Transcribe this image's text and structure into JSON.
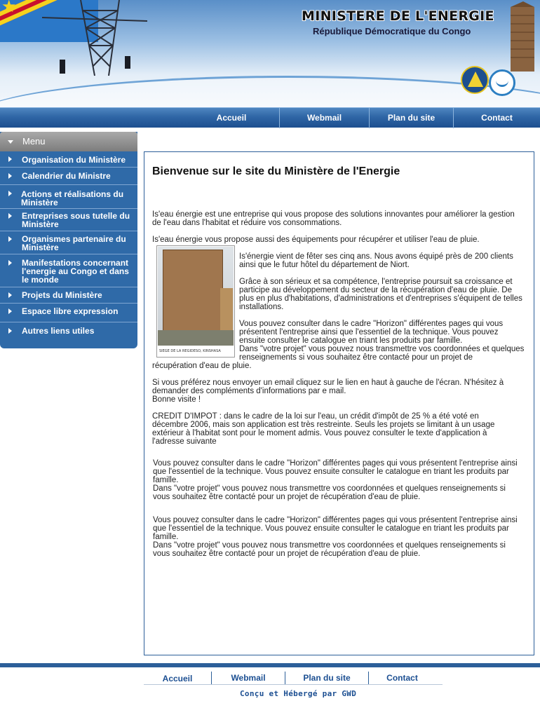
{
  "header": {
    "title": "MINISTERE DE L'ENERGIE",
    "subtitle": "République Démocratique du Congo"
  },
  "topnav": [
    "Accueil",
    "Webmail",
    "Plan du site",
    "Contact"
  ],
  "menu": {
    "header": "Menu",
    "items": [
      "Organisation du Ministère",
      "Calendrier du Ministre",
      "Actions et réalisations du Ministère",
      "Entreprises sous tutelle du Ministère",
      "Organismes partenaire du Ministère",
      "Manifestations concernant l'energie au Congo et dans le  monde",
      "Projets  du Ministère",
      "Espace libre expression",
      "Autres liens utiles"
    ]
  },
  "content": {
    "heading": "Bienvenue sur le site du Ministère de l'Energie",
    "p1": "Is'eau énergie est une entreprise qui vous propose des solutions innovantes pour améliorer la gestion de l'eau dans l'habitat et réduire vos consommations.",
    "p2": "Is'eau énergie vous propose aussi des équipements pour récupérer et utiliser l'eau de pluie.",
    "photo_caption": "SIEGE DE LA REGIDESO, KINSHASA",
    "p3": "Is'énergie vient de fêter ses cinq ans. Nous avons équipé près de 200 clients ainsi que le futur hôtel du département de Niort.",
    "p4": "Grâce à son sérieux et sa compétence, l'entreprise poursuit sa croissance et participe au développement du secteur de la récupération d'eau de pluie. De plus en plus d'habitations, d'administrations et d'entreprises s'équipent de telles installations.",
    "p5a": "Vous pouvez consulter dans le cadre \"Horizon\" différentes pages qui vous présentent l'entreprise ainsi que l'essentiel de la technique. Vous pouvez ensuite consulter le catalogue en triant les produits par famille.",
    "p5b": "Dans \"votre projet\" vous pouvez nous transmettre vos coordonnées et quelques renseignements si vous souhaitez être contacté pour un projet de",
    "p5c": "récupération d'eau de pluie.",
    "p6": "Si vous préférez nous envoyer un email cliquez sur le lien en haut à gauche de l'écran. N'hésitez à demander des compléments d'informations par e mail.",
    "p6b": "Bonne visite !",
    "p7": "CREDIT D'IMPOT : dans le cadre de la loi sur l'eau, un crédit d'impôt de 25 % a été voté en décembre 2006, mais son application est très restreinte. Seuls les projets se limitant à un usage extérieur à l'habitat sont pour le moment admis. Vous pouvez consulter le texte d'application à l'adresse suivante",
    "p8a": "Vous pouvez consulter dans le cadre \"Horizon\" différentes pages qui vous présentent l'entreprise ainsi que l'essentiel de la technique. Vous pouvez ensuite consulter le catalogue en triant les produits par famille.",
    "p8b": "Dans \"votre projet\" vous pouvez nous transmettre vos coordonnées et quelques renseignements si vous souhaitez être contacté pour un projet de récupération d'eau de pluie.",
    "p9a": "Vous pouvez consulter dans le cadre \"Horizon\" différentes pages qui vous présentent l'entreprise ainsi que l'essentiel de la technique. Vous pouvez ensuite consulter le catalogue en triant les produits par famille.",
    "p9b": "Dans \"votre projet\" vous pouvez nous transmettre vos coordonnées et quelques renseignements si vous souhaitez être contacté pour un projet de récupération d'eau de pluie."
  },
  "footer": {
    "nav": [
      "Accueil",
      "Webmail",
      "Plan du site",
      "Contact"
    ],
    "credit": "Conçu et Hébergé par GWD"
  },
  "colors": {
    "nav_blue": "#2f66a6",
    "menu_blue": "#2f6aa8",
    "border_blue": "#2c5f99",
    "footer_link": "#1c4f92"
  }
}
